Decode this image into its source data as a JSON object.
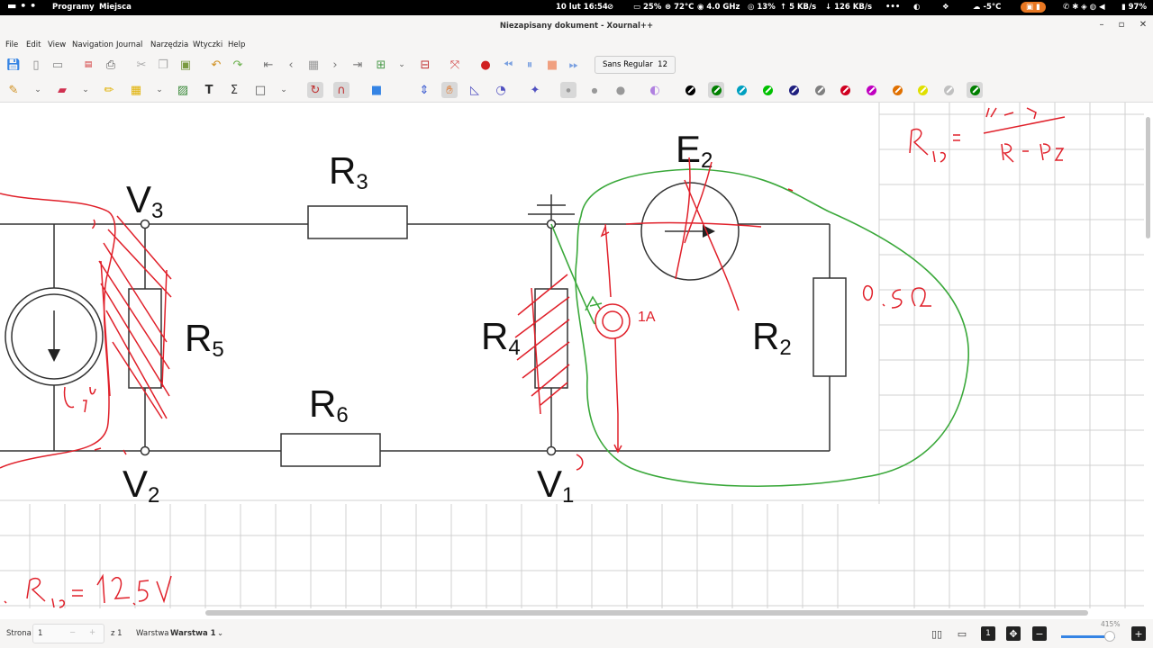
{
  "topbar": {
    "programs": "Programy",
    "places": "Miejsca",
    "datetime": "10 lut  16:54",
    "battery_pct": "25%",
    "temp": "72°C",
    "cpu_freq": "4.0 GHz",
    "cpu_load": "13%",
    "net_up": "5 KB/s",
    "net_down": "126 KB/s",
    "more": "•••",
    "weather": "-5°C",
    "battery_right": "97%"
  },
  "window": {
    "title": "Niezapisany dokument - Xournal++",
    "minimize": "–",
    "maximize": "▫",
    "close": "✕"
  },
  "menu": {
    "items": [
      "File",
      "Edit",
      "View",
      "Navigation",
      "Journal",
      "Narzędzia",
      "Wtyczki",
      "Help"
    ]
  },
  "toolbar": {
    "font_name": "Sans Regular",
    "font_size": "12"
  },
  "icons": {
    "save": "save-icon",
    "new": "new-document-icon",
    "open": "open-icon",
    "pdf": "pdf-icon",
    "print": "print-icon",
    "cut": "cut-icon",
    "copy": "copy-icon",
    "paste": "paste-icon",
    "undo": "undo-icon",
    "redo": "redo-icon",
    "first": "first-page-icon",
    "prev": "previous-page-icon",
    "goto": "goto-page-icon",
    "next": "next-page-icon",
    "last": "last-page-icon",
    "add_page": "add-page-icon",
    "delete_page": "delete-page-icon",
    "record": "record-icon",
    "rewind": "rewind-icon",
    "pause": "pause-icon",
    "stop": "stop-icon",
    "ffwd": "fast-forward-icon",
    "pen": "pen-icon",
    "eraser": "eraser-icon",
    "highlighter": "highlighter-icon",
    "select": "select-icon",
    "image": "image-icon",
    "text": "text-icon",
    "latex": "latex-icon",
    "shape": "shape-icon",
    "rotation_snap": "rotation-snap-icon",
    "grid_snap": "grid-snap-icon",
    "rect_select": "rect-select-icon",
    "vspace": "vertical-space-icon",
    "hand": "hand-icon",
    "ruler": "setsquare-icon",
    "compass": "compass-icon",
    "fill": "fill-icon",
    "fine": "fine-icon",
    "medium": "medium-icon",
    "thick": "thick-icon",
    "plugin": "plugin-icon"
  },
  "colors": {
    "pen_palette": [
      "#000000",
      "#008000",
      "#00a0c0",
      "#00c000",
      "#202080",
      "#808080",
      "#d00020",
      "#c000c0",
      "#e07000",
      "#e0e000",
      "#c0c0c0",
      "#008000"
    ],
    "ink_red": "#e0202a",
    "ink_green": "#3aa83a",
    "accent": "#e87722"
  },
  "circuit": {
    "labels": {
      "v3": "V",
      "v3_sub": "3",
      "v2": "V",
      "v2_sub": "2",
      "v1": "V",
      "v1_sub": "1",
      "r3": "R",
      "r3_sub": "3",
      "r5": "R",
      "r5_sub": "5",
      "r4": "R",
      "r4_sub": "4",
      "r6": "R",
      "r6_sub": "6",
      "r2": "R",
      "r2_sub": "2",
      "e2": "E",
      "e2_sub": "2"
    },
    "handwritten": {
      "current_1a": "1A",
      "half_ohm": "0.5Ω",
      "r15_formula_left": "R₁₅ =",
      "r15_numerator": "R₁·R₅",
      "r15_denominator": "R₁+R₅",
      "bottom_eq": "· R₁₅ = 12,5V",
      "ammeter_label": "a"
    }
  },
  "statusbar": {
    "page_label": "Strona",
    "page_value": "1",
    "page_of": "z 1",
    "layer_label": "Warstwa",
    "layer_value": "Warstwa 1",
    "zoom": "415%"
  }
}
